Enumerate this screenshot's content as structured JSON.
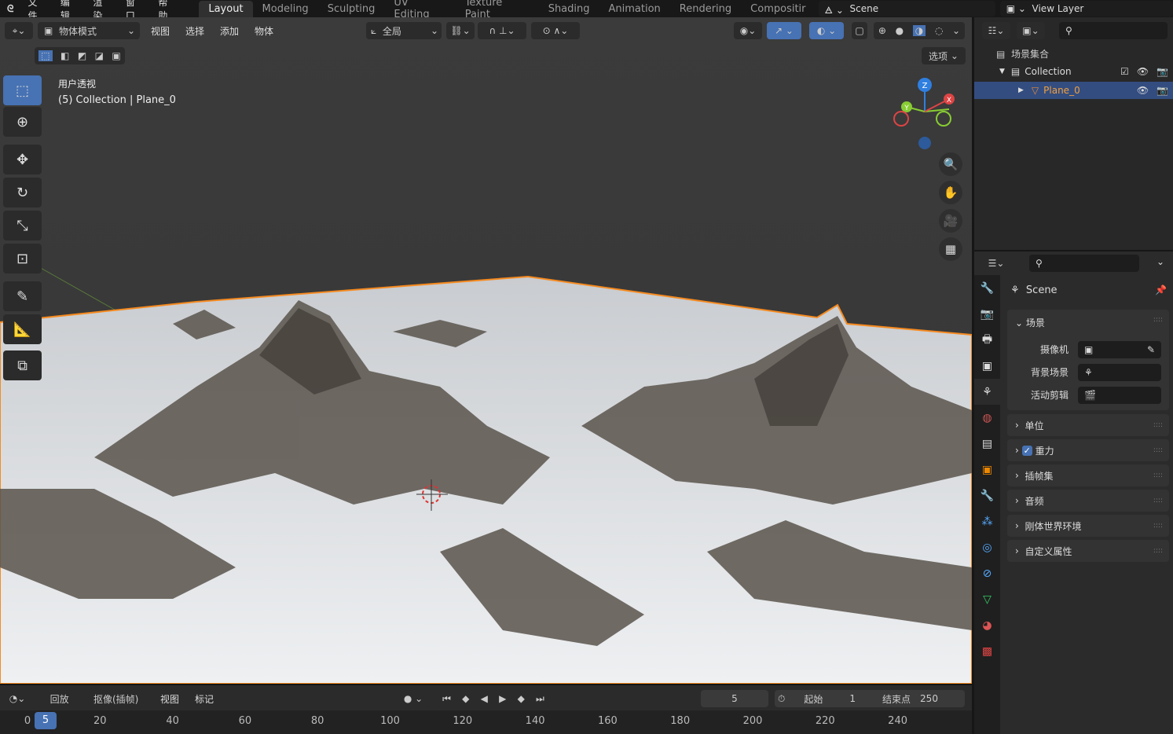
{
  "topbar": {
    "menus": [
      "文件",
      "编辑",
      "渲染",
      "窗口",
      "帮助"
    ],
    "workspaces": [
      "Layout",
      "Modeling",
      "Sculpting",
      "UV Editing",
      "Texture Paint",
      "Shading",
      "Animation",
      "Rendering",
      "Compositir"
    ],
    "active_workspace": "Layout",
    "scene": "Scene",
    "view_layer": "View Layer"
  },
  "viewport": {
    "mode": "物体模式",
    "menus": [
      "视图",
      "选择",
      "添加",
      "物体"
    ],
    "transform_orientation": "全局",
    "options_label": "选项",
    "view_name": "用户透视",
    "object_info": "(5) Collection | Plane_0",
    "gizmo_axes": [
      "X",
      "Y",
      "Z"
    ],
    "accent": "#4772b3",
    "selection_outline": "#f58a20"
  },
  "tools": [
    "select-box",
    "cursor",
    "move",
    "rotate",
    "scale",
    "transform",
    "annotate",
    "measure",
    "add-cube"
  ],
  "outliner": {
    "root": "场景集合",
    "collection": "Collection",
    "object": "Plane_0"
  },
  "properties": {
    "title": "Scene",
    "section": "场景",
    "fields": [
      {
        "label": "摄像机"
      },
      {
        "label": "背景场景"
      },
      {
        "label": "活动剪辑"
      }
    ],
    "panels": [
      "单位",
      "重力",
      "插帧集",
      "音频",
      "刚体世界环境",
      "自定义属性"
    ],
    "gravity_checked": true
  },
  "timeline": {
    "playback": "回放",
    "keying": "抠像(插帧)",
    "menus": [
      "视图",
      "标记"
    ],
    "current_frame": "5",
    "start_label": "起始",
    "start": "1",
    "end_label": "结束点",
    "end": "250",
    "ticks": [
      "0",
      "20",
      "40",
      "60",
      "80",
      "100",
      "120",
      "140",
      "160",
      "180",
      "200",
      "220",
      "240"
    ],
    "current_marker": "5"
  }
}
